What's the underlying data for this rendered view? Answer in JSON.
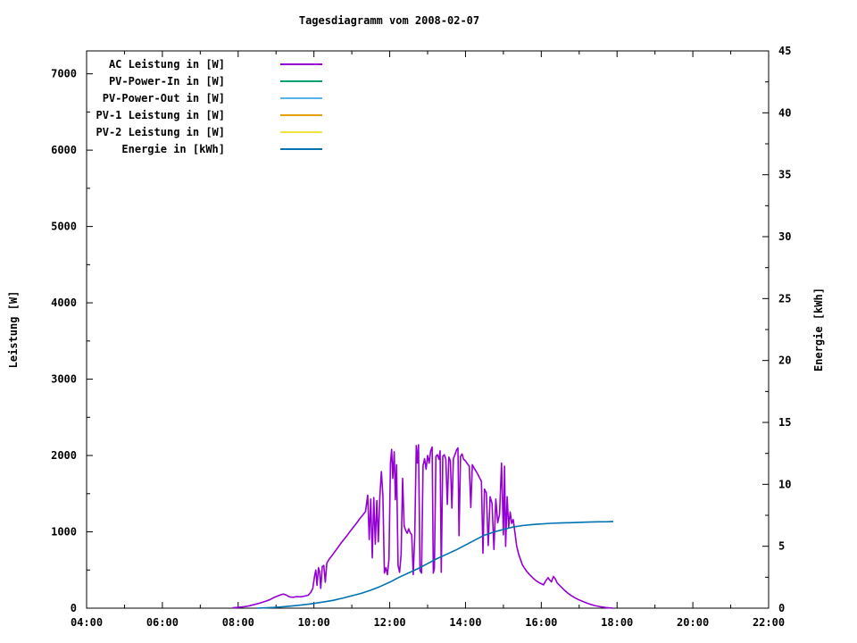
{
  "title": "Tagesdiagramm vom 2008-02-07",
  "legend": {
    "items": [
      {
        "label": "AC Leistung in [W]",
        "color": "#9400d3"
      },
      {
        "label": "PV-Power-In in [W]",
        "color": "#009e73"
      },
      {
        "label": "PV-Power-Out in [W]",
        "color": "#56b4e9"
      },
      {
        "label": "PV-1 Leistung in [W]",
        "color": "#e69f00"
      },
      {
        "label": "PV-2 Leistung in [W]",
        "color": "#f0e442"
      },
      {
        "label": "Energie in [kWh]",
        "color": "#0072b2"
      }
    ]
  },
  "chart_data": {
    "type": "line",
    "title": "Tagesdiagramm vom 2008-02-07",
    "xlabel": "",
    "ylabel": "Leistung [W]",
    "y2label": "Energie [kWh]",
    "xlim": [
      4,
      22
    ],
    "ylim": [
      0,
      7300
    ],
    "y2lim": [
      0,
      45
    ],
    "grid": false,
    "legend_position": "inside-top-left",
    "x_ticks": {
      "major": [
        {
          "v": 4,
          "label": "04:00"
        },
        {
          "v": 6,
          "label": "06:00"
        },
        {
          "v": 8,
          "label": "08:00"
        },
        {
          "v": 10,
          "label": "10:00"
        },
        {
          "v": 12,
          "label": "12:00"
        },
        {
          "v": 14,
          "label": "14:00"
        },
        {
          "v": 16,
          "label": "16:00"
        },
        {
          "v": 18,
          "label": "18:00"
        },
        {
          "v": 20,
          "label": "20:00"
        },
        {
          "v": 22,
          "label": "22:00"
        }
      ],
      "minor": [
        5,
        7,
        9,
        11,
        13,
        15,
        17,
        19,
        21
      ]
    },
    "y_ticks": {
      "major": [
        {
          "v": 0,
          "label": "0"
        },
        {
          "v": 1000,
          "label": "1000"
        },
        {
          "v": 2000,
          "label": "2000"
        },
        {
          "v": 3000,
          "label": "3000"
        },
        {
          "v": 4000,
          "label": "4000"
        },
        {
          "v": 5000,
          "label": "5000"
        },
        {
          "v": 6000,
          "label": "6000"
        },
        {
          "v": 7000,
          "label": "7000"
        }
      ],
      "minor": [
        500,
        1500,
        2500,
        3500,
        4500,
        5500,
        6500
      ]
    },
    "y2_ticks": {
      "major": [
        {
          "v": 0,
          "label": "0"
        },
        {
          "v": 5,
          "label": "5"
        },
        {
          "v": 10,
          "label": "10"
        },
        {
          "v": 15,
          "label": "15"
        },
        {
          "v": 20,
          "label": "20"
        },
        {
          "v": 25,
          "label": "25"
        },
        {
          "v": 30,
          "label": "30"
        },
        {
          "v": 35,
          "label": "35"
        },
        {
          "v": 40,
          "label": "40"
        },
        {
          "v": 45,
          "label": "45"
        }
      ],
      "minor": [
        2.5,
        7.5,
        12.5,
        17.5,
        22.5,
        27.5,
        32.5,
        37.5,
        42.5
      ]
    },
    "series": [
      {
        "name": "AC Leistung in [W]",
        "color": "#9400d3",
        "axis": "y",
        "points": [
          [
            7.85,
            5
          ],
          [
            8.0,
            10
          ],
          [
            8.1,
            15
          ],
          [
            8.2,
            22
          ],
          [
            8.3,
            32
          ],
          [
            8.45,
            50
          ],
          [
            8.6,
            70
          ],
          [
            8.75,
            95
          ],
          [
            8.85,
            115
          ],
          [
            8.95,
            140
          ],
          [
            9.05,
            160
          ],
          [
            9.15,
            180
          ],
          [
            9.2,
            185
          ],
          [
            9.28,
            170
          ],
          [
            9.35,
            148
          ],
          [
            9.45,
            143
          ],
          [
            9.55,
            152
          ],
          [
            9.65,
            148
          ],
          [
            9.75,
            158
          ],
          [
            9.85,
            170
          ],
          [
            9.92,
            210
          ],
          [
            9.97,
            260
          ],
          [
            10.02,
            430
          ],
          [
            10.05,
            500
          ],
          [
            10.08,
            300
          ],
          [
            10.12,
            530
          ],
          [
            10.15,
            480
          ],
          [
            10.18,
            260
          ],
          [
            10.22,
            545
          ],
          [
            10.26,
            560
          ],
          [
            10.3,
            340
          ],
          [
            10.34,
            590
          ],
          [
            10.4,
            640
          ],
          [
            10.48,
            690
          ],
          [
            10.56,
            745
          ],
          [
            10.64,
            800
          ],
          [
            10.72,
            855
          ],
          [
            10.8,
            905
          ],
          [
            10.88,
            955
          ],
          [
            10.96,
            1010
          ],
          [
            11.04,
            1060
          ],
          [
            11.12,
            1110
          ],
          [
            11.2,
            1165
          ],
          [
            11.28,
            1215
          ],
          [
            11.36,
            1265
          ],
          [
            11.42,
            1480
          ],
          [
            11.46,
            900
          ],
          [
            11.5,
            1430
          ],
          [
            11.54,
            660
          ],
          [
            11.58,
            1450
          ],
          [
            11.62,
            840
          ],
          [
            11.66,
            1410
          ],
          [
            11.7,
            870
          ],
          [
            11.74,
            1460
          ],
          [
            11.78,
            1790
          ],
          [
            11.82,
            1480
          ],
          [
            11.86,
            460
          ],
          [
            11.9,
            530
          ],
          [
            11.94,
            440
          ],
          [
            11.98,
            640
          ],
          [
            12.02,
            1900
          ],
          [
            12.05,
            2080
          ],
          [
            12.08,
            1700
          ],
          [
            12.12,
            2050
          ],
          [
            12.15,
            1420
          ],
          [
            12.18,
            1880
          ],
          [
            12.22,
            560
          ],
          [
            12.26,
            470
          ],
          [
            12.3,
            700
          ],
          [
            12.34,
            1700
          ],
          [
            12.38,
            1080
          ],
          [
            12.42,
            1020
          ],
          [
            12.46,
            980
          ],
          [
            12.5,
            1040
          ],
          [
            12.54,
            990
          ],
          [
            12.58,
            960
          ],
          [
            12.62,
            440
          ],
          [
            12.66,
            950
          ],
          [
            12.7,
            2130
          ],
          [
            12.73,
            1900
          ],
          [
            12.76,
            2140
          ],
          [
            12.8,
            490
          ],
          [
            12.84,
            460
          ],
          [
            12.88,
            1870
          ],
          [
            12.92,
            1960
          ],
          [
            12.96,
            1820
          ],
          [
            13.0,
            2000
          ],
          [
            13.04,
            1900
          ],
          [
            13.08,
            2060
          ],
          [
            13.12,
            2110
          ],
          [
            13.15,
            460
          ],
          [
            13.18,
            520
          ],
          [
            13.22,
            1990
          ],
          [
            13.26,
            2010
          ],
          [
            13.3,
            1950
          ],
          [
            13.33,
            2060
          ],
          [
            13.36,
            470
          ],
          [
            13.4,
            1990
          ],
          [
            13.44,
            2010
          ],
          [
            13.48,
            1950
          ],
          [
            13.52,
            1360
          ],
          [
            13.56,
            1980
          ],
          [
            13.6,
            1930
          ],
          [
            13.64,
            1310
          ],
          [
            13.68,
            1960
          ],
          [
            13.72,
            2010
          ],
          [
            13.76,
            2070
          ],
          [
            13.8,
            2100
          ],
          [
            13.83,
            950
          ],
          [
            13.87,
            1990
          ],
          [
            13.91,
            2020
          ],
          [
            13.95,
            1950
          ],
          [
            14.0,
            1930
          ],
          [
            14.05,
            1890
          ],
          [
            14.1,
            1860
          ],
          [
            14.14,
            1320
          ],
          [
            14.18,
            1880
          ],
          [
            14.22,
            1840
          ],
          [
            14.27,
            1800
          ],
          [
            14.32,
            1760
          ],
          [
            14.37,
            1710
          ],
          [
            14.42,
            1660
          ],
          [
            14.46,
            720
          ],
          [
            14.5,
            1560
          ],
          [
            14.55,
            1510
          ],
          [
            14.6,
            820
          ],
          [
            14.65,
            1460
          ],
          [
            14.7,
            1370
          ],
          [
            14.75,
            770
          ],
          [
            14.8,
            1430
          ],
          [
            14.85,
            1120
          ],
          [
            14.9,
            1230
          ],
          [
            14.95,
            1900
          ],
          [
            15.0,
            960
          ],
          [
            15.03,
            1860
          ],
          [
            15.06,
            810
          ],
          [
            15.1,
            1460
          ],
          [
            15.14,
            1060
          ],
          [
            15.18,
            1260
          ],
          [
            15.22,
            1110
          ],
          [
            15.26,
            1160
          ],
          [
            15.3,
            1010
          ],
          [
            15.35,
            820
          ],
          [
            15.4,
            710
          ],
          [
            15.45,
            640
          ],
          [
            15.5,
            570
          ],
          [
            15.55,
            530
          ],
          [
            15.62,
            480
          ],
          [
            15.7,
            435
          ],
          [
            15.78,
            395
          ],
          [
            15.86,
            360
          ],
          [
            15.94,
            335
          ],
          [
            16.0,
            320
          ],
          [
            16.06,
            305
          ],
          [
            16.12,
            360
          ],
          [
            16.18,
            400
          ],
          [
            16.22,
            370
          ],
          [
            16.27,
            345
          ],
          [
            16.32,
            415
          ],
          [
            16.37,
            385
          ],
          [
            16.42,
            330
          ],
          [
            16.5,
            290
          ],
          [
            16.6,
            240
          ],
          [
            16.7,
            198
          ],
          [
            16.8,
            162
          ],
          [
            16.9,
            132
          ],
          [
            17.0,
            108
          ],
          [
            17.1,
            88
          ],
          [
            17.2,
            68
          ],
          [
            17.3,
            50
          ],
          [
            17.4,
            35
          ],
          [
            17.5,
            24
          ],
          [
            17.6,
            15
          ],
          [
            17.7,
            8
          ],
          [
            17.8,
            3
          ],
          [
            17.9,
            0
          ]
        ]
      },
      {
        "name": "PV-Power-In in [W]",
        "color": "#009e73",
        "axis": "y",
        "points": []
      },
      {
        "name": "PV-Power-Out in [W]",
        "color": "#56b4e9",
        "axis": "y",
        "points": []
      },
      {
        "name": "PV-1 Leistung in [W]",
        "color": "#e69f00",
        "axis": "y",
        "points": []
      },
      {
        "name": "PV-2 Leistung in [W]",
        "color": "#f0e442",
        "axis": "y",
        "points": []
      },
      {
        "name": "Energie in [kWh]",
        "color": "#0072b2",
        "axis": "y2",
        "points": [
          [
            8.5,
            0.0
          ],
          [
            8.75,
            0.03
          ],
          [
            9.0,
            0.07
          ],
          [
            9.25,
            0.13
          ],
          [
            9.5,
            0.2
          ],
          [
            9.75,
            0.28
          ],
          [
            10.0,
            0.38
          ],
          [
            10.25,
            0.5
          ],
          [
            10.5,
            0.63
          ],
          [
            10.75,
            0.8
          ],
          [
            11.0,
            1.0
          ],
          [
            11.25,
            1.2
          ],
          [
            11.5,
            1.45
          ],
          [
            11.75,
            1.75
          ],
          [
            12.0,
            2.1
          ],
          [
            12.25,
            2.5
          ],
          [
            12.5,
            2.85
          ],
          [
            12.75,
            3.2
          ],
          [
            13.0,
            3.6
          ],
          [
            13.25,
            4.0
          ],
          [
            13.5,
            4.35
          ],
          [
            13.75,
            4.7
          ],
          [
            14.0,
            5.1
          ],
          [
            14.25,
            5.5
          ],
          [
            14.5,
            5.9
          ],
          [
            14.75,
            6.15
          ],
          [
            15.0,
            6.35
          ],
          [
            15.25,
            6.55
          ],
          [
            15.5,
            6.67
          ],
          [
            15.75,
            6.75
          ],
          [
            16.0,
            6.8
          ],
          [
            16.25,
            6.85
          ],
          [
            16.5,
            6.88
          ],
          [
            16.75,
            6.9
          ],
          [
            17.0,
            6.93
          ],
          [
            17.25,
            6.95
          ],
          [
            17.5,
            6.97
          ],
          [
            17.75,
            6.98
          ],
          [
            17.9,
            7.0
          ]
        ]
      }
    ]
  }
}
